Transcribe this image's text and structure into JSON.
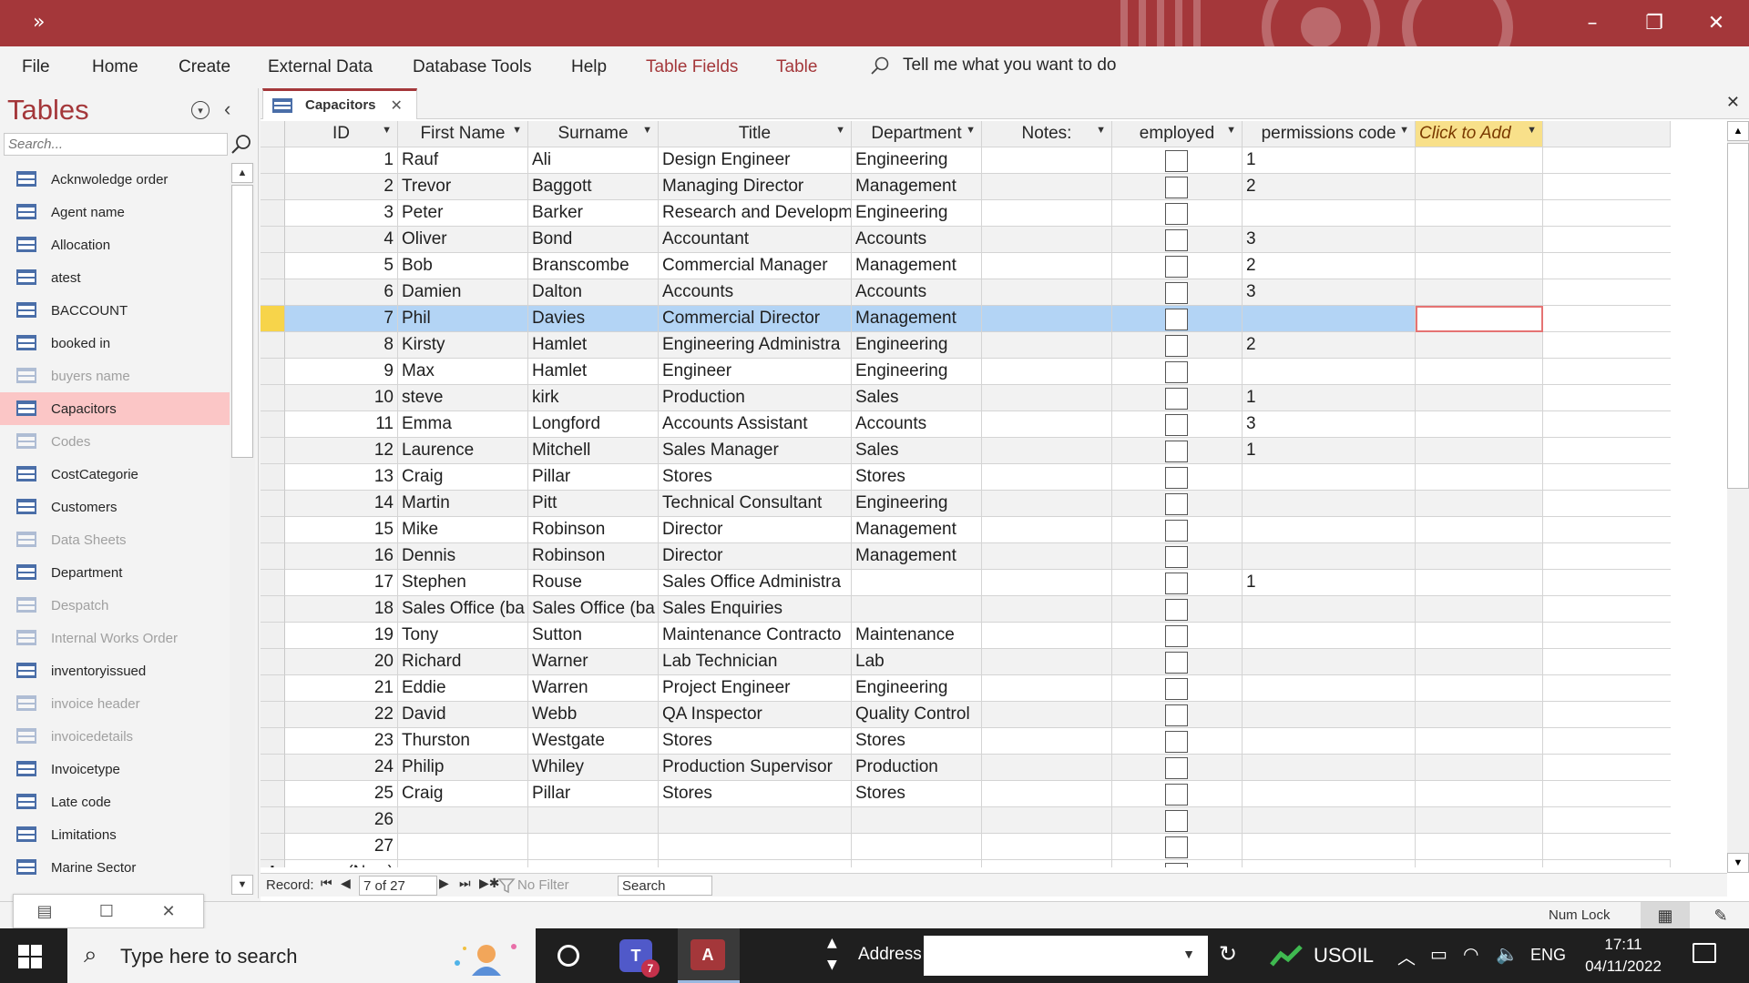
{
  "titlebar": {
    "qa_label": "»",
    "min": "–",
    "restore": "❐",
    "close": "✕"
  },
  "ribbon": {
    "tabs": [
      "File",
      "Home",
      "Create",
      "External Data",
      "Database Tools",
      "Help",
      "Table Fields",
      "Table"
    ],
    "tell_me": "Tell me what you want to do"
  },
  "nav": {
    "title": "Tables",
    "search_placeholder": "Search...",
    "items": [
      {
        "label": "Acknwoledge order",
        "dim": false
      },
      {
        "label": "Agent name",
        "dim": false
      },
      {
        "label": "Allocation",
        "dim": false
      },
      {
        "label": "atest",
        "dim": false
      },
      {
        "label": "BACCOUNT",
        "dim": false
      },
      {
        "label": "booked in",
        "dim": false
      },
      {
        "label": "buyers name",
        "dim": true
      },
      {
        "label": "Capacitors",
        "dim": false,
        "selected": true
      },
      {
        "label": "Codes",
        "dim": true
      },
      {
        "label": "CostCategorie",
        "dim": false
      },
      {
        "label": "Customers",
        "dim": false
      },
      {
        "label": "Data Sheets",
        "dim": true
      },
      {
        "label": "Department",
        "dim": false
      },
      {
        "label": "Despatch",
        "dim": true
      },
      {
        "label": "Internal Works Order",
        "dim": true
      },
      {
        "label": "inventoryissued",
        "dim": false
      },
      {
        "label": "invoice header",
        "dim": true
      },
      {
        "label": "invoicedetails",
        "dim": true
      },
      {
        "label": "Invoicetype",
        "dim": false
      },
      {
        "label": "Late code",
        "dim": false
      },
      {
        "label": "Limitations",
        "dim": false
      },
      {
        "label": "Marine Sector",
        "dim": false
      }
    ]
  },
  "document": {
    "tab_label": "Capacitors",
    "columns": [
      "ID",
      "First Name",
      "Surname",
      "Title",
      "Department",
      "Notes:",
      "employed",
      "permissions code",
      "Click to Add"
    ],
    "rows": [
      {
        "id": "1",
        "first": "Rauf",
        "surname": "Ali",
        "title": "Design Engineer",
        "dept": "Engineering",
        "notes": "",
        "perm": "1"
      },
      {
        "id": "2",
        "first": "Trevor",
        "surname": "Baggott",
        "title": "Managing Director",
        "dept": "Management",
        "notes": "",
        "perm": "2"
      },
      {
        "id": "3",
        "first": "Peter",
        "surname": "Barker",
        "title": "Research and Developm",
        "dept": "Engineering",
        "notes": "",
        "perm": ""
      },
      {
        "id": "4",
        "first": "Oliver",
        "surname": "Bond",
        "title": "Accountant",
        "dept": "Accounts",
        "notes": "",
        "perm": "3"
      },
      {
        "id": "5",
        "first": "Bob",
        "surname": "Branscombe",
        "title": "Commercial Manager",
        "dept": "Management",
        "notes": "",
        "perm": "2"
      },
      {
        "id": "6",
        "first": "Damien",
        "surname": "Dalton",
        "title": "Accounts",
        "dept": "Accounts",
        "notes": "",
        "perm": "3"
      },
      {
        "id": "7",
        "first": "Phil",
        "surname": "Davies",
        "title": "Commercial Director",
        "dept": "Management",
        "notes": "",
        "perm": "",
        "current": true
      },
      {
        "id": "8",
        "first": "Kirsty",
        "surname": "Hamlet",
        "title": "Engineering Administra",
        "dept": "Engineering",
        "notes": "",
        "perm": "2"
      },
      {
        "id": "9",
        "first": "Max",
        "surname": "Hamlet",
        "title": "Engineer",
        "dept": "Engineering",
        "notes": "",
        "perm": ""
      },
      {
        "id": "10",
        "first": "steve",
        "surname": "kirk",
        "title": "Production",
        "dept": "Sales",
        "notes": "",
        "perm": "1"
      },
      {
        "id": "11",
        "first": "Emma",
        "surname": "Longford",
        "title": "Accounts Assistant",
        "dept": "Accounts",
        "notes": "",
        "perm": "3"
      },
      {
        "id": "12",
        "first": "Laurence",
        "surname": "Mitchell",
        "title": "Sales Manager",
        "dept": "Sales",
        "notes": "",
        "perm": "1"
      },
      {
        "id": "13",
        "first": "Craig",
        "surname": "Pillar",
        "title": "Stores",
        "dept": "Stores",
        "notes": "",
        "perm": ""
      },
      {
        "id": "14",
        "first": "Martin",
        "surname": "Pitt",
        "title": "Technical Consultant",
        "dept": "Engineering",
        "notes": "",
        "perm": ""
      },
      {
        "id": "15",
        "first": "Mike",
        "surname": "Robinson",
        "title": "Director",
        "dept": "Management",
        "notes": "",
        "perm": ""
      },
      {
        "id": "16",
        "first": "Dennis",
        "surname": "Robinson",
        "title": "Director",
        "dept": "Management",
        "notes": "",
        "perm": ""
      },
      {
        "id": "17",
        "first": "Stephen",
        "surname": "Rouse",
        "title": "Sales Office Administra",
        "dept": "",
        "notes": "",
        "perm": "1"
      },
      {
        "id": "18",
        "first": "Sales Office (ba",
        "surname": "Sales Office (ba",
        "title": "Sales Enquiries",
        "dept": "",
        "notes": "",
        "perm": ""
      },
      {
        "id": "19",
        "first": "Tony",
        "surname": "Sutton",
        "title": "Maintenance Contracto",
        "dept": "Maintenance",
        "notes": "",
        "perm": ""
      },
      {
        "id": "20",
        "first": "Richard",
        "surname": "Warner",
        "title": "Lab Technician",
        "dept": "Lab",
        "notes": "",
        "perm": ""
      },
      {
        "id": "21",
        "first": "Eddie",
        "surname": "Warren",
        "title": "Project Engineer",
        "dept": "Engineering",
        "notes": "",
        "perm": ""
      },
      {
        "id": "22",
        "first": "David",
        "surname": "Webb",
        "title": "QA Inspector",
        "dept": "Quality Control",
        "notes": "",
        "perm": ""
      },
      {
        "id": "23",
        "first": "Thurston",
        "surname": "Westgate",
        "title": "Stores",
        "dept": "Stores",
        "notes": "",
        "perm": ""
      },
      {
        "id": "24",
        "first": "Philip",
        "surname": "Whiley",
        "title": "Production Supervisor",
        "dept": "Production",
        "notes": "",
        "perm": ""
      },
      {
        "id": "25",
        "first": "Craig",
        "surname": "Pillar",
        "title": "Stores",
        "dept": "Stores",
        "notes": "",
        "perm": ""
      },
      {
        "id": "26",
        "first": "",
        "surname": "",
        "title": "",
        "dept": "",
        "notes": "",
        "perm": ""
      },
      {
        "id": "27",
        "first": "",
        "surname": "",
        "title": "",
        "dept": "",
        "notes": "",
        "perm": ""
      }
    ],
    "new_row_marker": "✱",
    "new_row_label": "(New)"
  },
  "recordnav": {
    "label": "Record:",
    "position": "7 of 27",
    "no_filter": "No Filter",
    "search": "Search"
  },
  "status": {
    "numlock": "Num Lock"
  },
  "taskbar": {
    "search_placeholder": "Type here to search",
    "teams_badge": "7",
    "address_label": "Address",
    "usoil": "USOIL",
    "lang": "ENG",
    "time": "17:11",
    "date": "04/11/2022"
  },
  "colors": {
    "accent": "#a4373a",
    "selection": "#b3d4f5",
    "nav_selected": "#fbc6c6",
    "click_to_add": "#f8e08a"
  }
}
